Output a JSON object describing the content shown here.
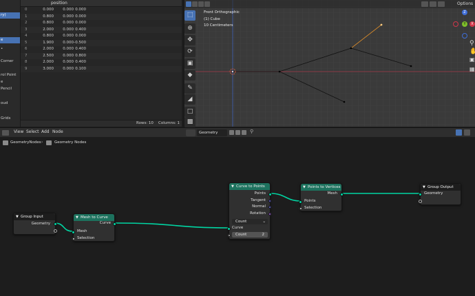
{
  "spreadsheet": {
    "column_header": "position",
    "left_items": [
      "ry)",
      "e",
      "Corner",
      "rol Point",
      "e",
      "Pencil",
      "oud",
      "",
      "Grids"
    ],
    "rows": [
      {
        "i": "0",
        "x": "0.000",
        "y": "0.000",
        "z": "0.000"
      },
      {
        "i": "1",
        "x": "0.800",
        "y": "0.000",
        "z": "0.000"
      },
      {
        "i": "2",
        "x": "0.800",
        "y": "0.000",
        "z": "0.000"
      },
      {
        "i": "3",
        "x": "2.000",
        "y": "0.000",
        "z": "0.400"
      },
      {
        "i": "4",
        "x": "0.800",
        "y": "0.000",
        "z": "0.000"
      },
      {
        "i": "5",
        "x": "1.900",
        "y": "0.000",
        "z": "-0.500"
      },
      {
        "i": "6",
        "x": "2.000",
        "y": "0.000",
        "z": "0.400"
      },
      {
        "i": "7",
        "x": "2.500",
        "y": "0.000",
        "z": "0.800"
      },
      {
        "i": "8",
        "x": "2.000",
        "y": "0.000",
        "z": "0.400"
      },
      {
        "i": "9",
        "x": "3.000",
        "y": "0.000",
        "z": "0.100"
      }
    ],
    "rows_label": "Rows: 10",
    "columns_label": "Columns: 1"
  },
  "viewport": {
    "view_name": "Front Orthographic",
    "object": "(1) Cube",
    "scale": "10 Centimeters",
    "options_label": "Options",
    "gizmo_z": "Z",
    "gizmo_y": "Y",
    "gizmo_x": "X"
  },
  "node_editor": {
    "menu": [
      "View",
      "Select",
      "Add",
      "Node"
    ],
    "tree_name": "Geometry Nodes",
    "breadcrumb_1": "GeometryNodes",
    "breadcrumb_2": "Geometry Nodes",
    "nodes": {
      "group_input": {
        "title": "Group Input",
        "out_geometry": "Geometry"
      },
      "mesh_to_curve": {
        "title": "Mesh to Curve",
        "out_curve": "Curve",
        "in_mesh": "Mesh",
        "in_selection": "Selection"
      },
      "curve_to_points": {
        "title": "Curve to Points",
        "out_points": "Points",
        "out_tangent": "Tangent",
        "out_normal": "Normal",
        "out_rotation": "Rotation",
        "mode": "Count",
        "in_curve": "Curve",
        "count_label": "Count",
        "count_value": "2"
      },
      "points_to_vertices": {
        "title": "Points to Vertices",
        "out_mesh": "Mesh",
        "in_points": "Points",
        "in_selection": "Selection"
      },
      "group_output": {
        "title": "Group Output",
        "in_geometry": "Geometry"
      }
    }
  },
  "colors": {
    "accent": "#4772b3",
    "geometry_socket": "#00d6a3",
    "node_header_green": "#1d725e"
  }
}
